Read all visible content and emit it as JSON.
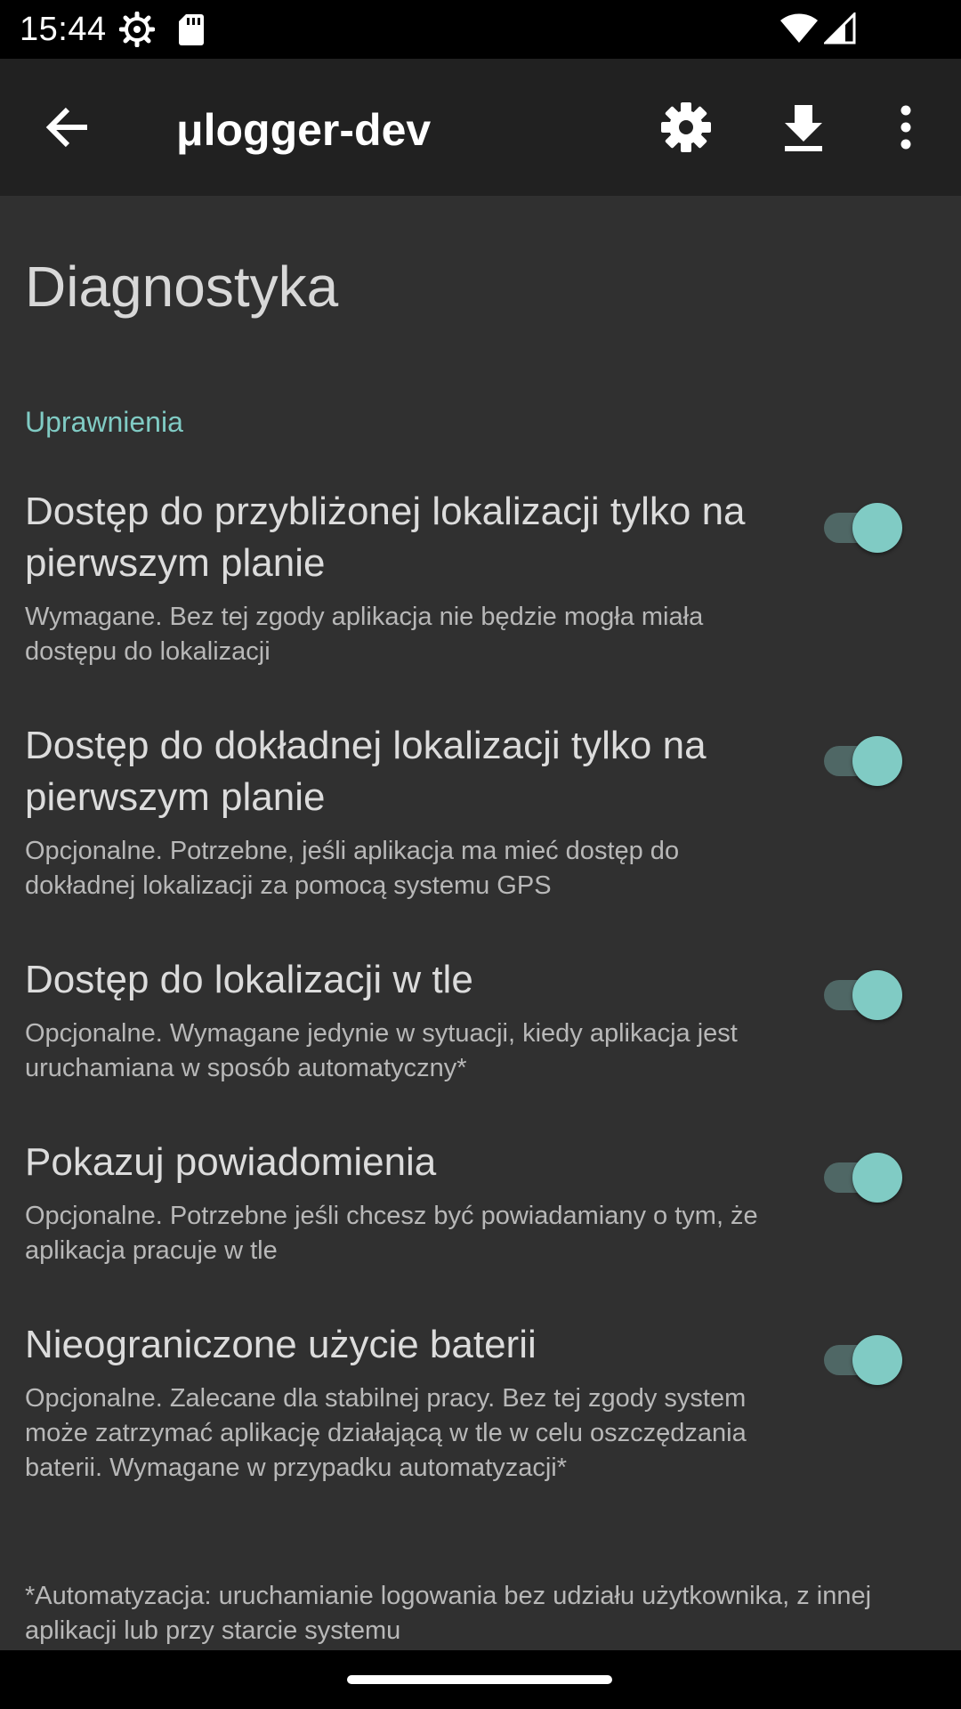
{
  "status_bar": {
    "time": "15:44",
    "icons": [
      "gear-icon",
      "sd-card-icon",
      "wifi-icon",
      "signal-icon"
    ]
  },
  "app_bar": {
    "title": "μlogger-dev",
    "icons": [
      "back-arrow-icon",
      "settings-gear-icon",
      "download-icon",
      "more-vert-icon"
    ]
  },
  "page": {
    "title": "Diagnostyka",
    "section_header": "Uprawnienia",
    "preferences": [
      {
        "title": "Dostęp do przybliżonej lokalizacji tylko na pierwszym planie",
        "summary": "Wymagane. Bez tej zgody aplikacja nie będzie mogła miała dostępu do lokalizacji",
        "checked": true
      },
      {
        "title": "Dostęp do dokładnej lokalizacji tylko na pierwszym planie",
        "summary": "Opcjonalne. Potrzebne, jeśli aplikacja ma mieć dostęp do dokładnej lokalizacji za pomocą systemu GPS",
        "checked": true
      },
      {
        "title": "Dostęp do lokalizacji w tle",
        "summary": "Opcjonalne. Wymagane jedynie w sytuacji, kiedy aplikacja jest uruchamiana w sposób automatyczny*",
        "checked": true
      },
      {
        "title": "Pokazuj powiadomienia",
        "summary": "Opcjonalne. Potrzebne jeśli chcesz być powiadamiany o tym, że aplikacja pracuje w tle",
        "checked": true
      },
      {
        "title": "Nieograniczone użycie baterii",
        "summary": "Opcjonalne. Zalecane dla stabilnej pracy. Bez tej zgody system może zatrzymać aplikację działającą w tle w celu oszczędzania baterii. Wymagane w przypadku automatyzacji*",
        "checked": true
      }
    ],
    "footnote": "*Automatyzacja: uruchamianie logowania bez udziału użytkownika, z innej aplikacji lub przy starcie systemu"
  },
  "colors": {
    "accent": "#80cbc4",
    "background": "#303030",
    "app_bar": "#212121"
  }
}
